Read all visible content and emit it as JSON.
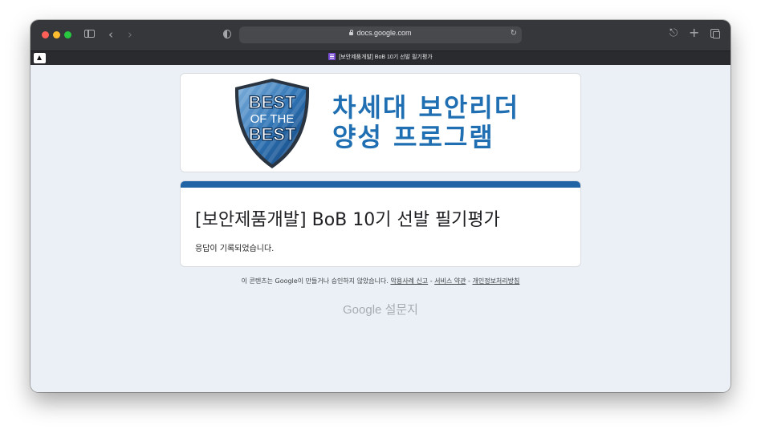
{
  "browser": {
    "url": "docs.google.com",
    "tab_title": "[보안제품개발] BoB 10기 선발 필기평가"
  },
  "banner": {
    "badge_line1": "BEST",
    "badge_line2": "OF THE",
    "badge_line3": "BEST",
    "title_line1": "차세대 보안리더",
    "title_line2": "양성 프로그램"
  },
  "form": {
    "title": "[보안제품개발] BoB 10기 선발 필기평가",
    "response_message": "응답이 기록되었습니다."
  },
  "footer": {
    "disclaimer": "이 콘텐츠는 Google이 만들거나 승인하지 않았습니다.",
    "report_link": "악용사례 신고",
    "terms_link": "서비스 약관",
    "privacy_link": "개인정보처리방침",
    "separator": "-",
    "logo_google": "Google",
    "logo_forms": "설문지"
  },
  "colors": {
    "accent": "#2164a6",
    "banner_text": "#1f6fb2",
    "page_bg": "#ebf0f6"
  }
}
